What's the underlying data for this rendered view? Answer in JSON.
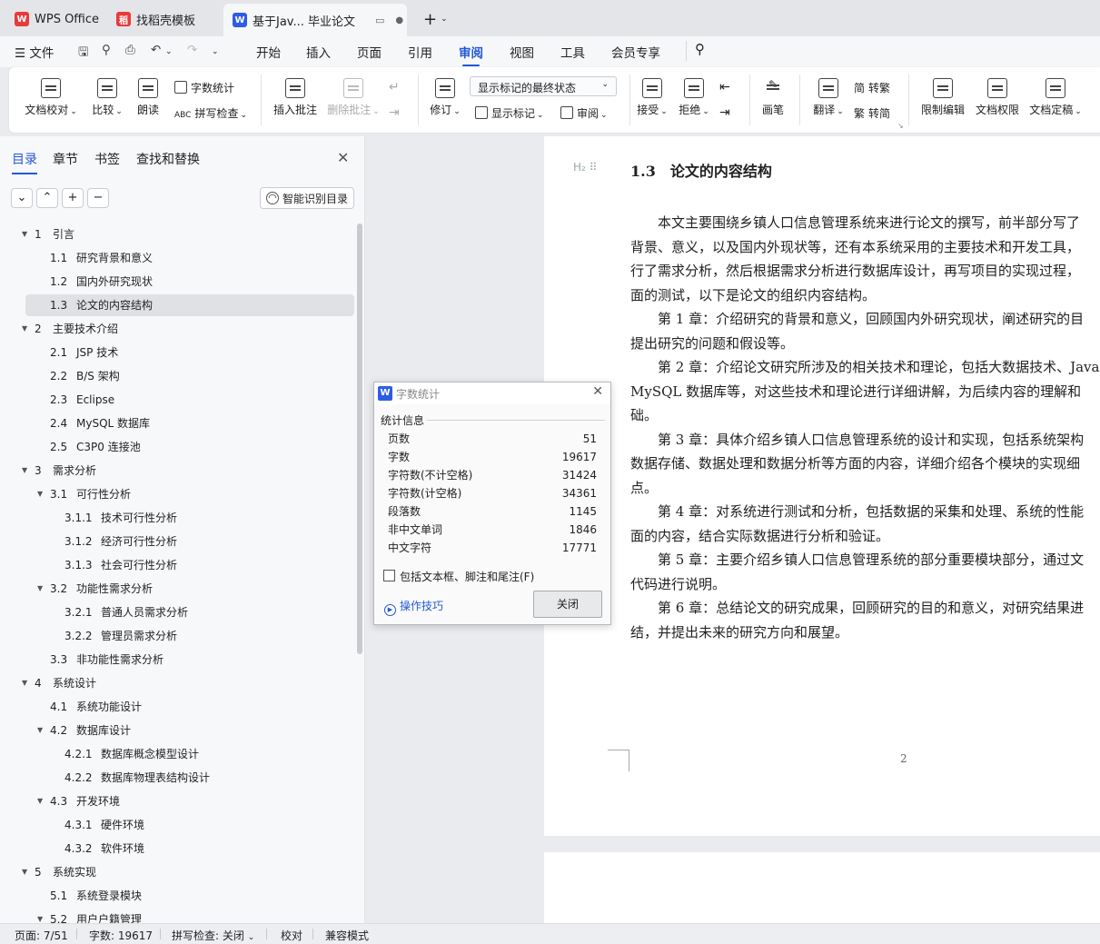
{
  "tabs": [
    {
      "label": "WPS Office",
      "icon": "wps-logo-icon"
    },
    {
      "label": "找稻壳模板",
      "icon": "docer-icon"
    },
    {
      "label": "基于Jav... 毕业论文",
      "icon": "writer-icon"
    }
  ],
  "menu": {
    "file": "文件",
    "items": [
      "开始",
      "插入",
      "页面",
      "引用",
      "审阅",
      "视图",
      "工具",
      "会员专享"
    ],
    "active": "审阅"
  },
  "ribbon": {
    "doc_check": "文档校对",
    "compare": "比较",
    "read_aloud": "朗读",
    "word_count": "字数统计",
    "spell_check": "拼写检查",
    "insert_comment": "插入批注",
    "delete_comment": "删除批注",
    "revise": "修订",
    "markup_state": "显示标记的最终状态",
    "show_markup": "显示标记",
    "review_pane": "审阅",
    "accept": "接受",
    "reject": "拒绝",
    "pen": "画笔",
    "translate": "翻译",
    "to_traditional": "转繁",
    "to_simplified": "转简",
    "restrict_edit": "限制编辑",
    "doc_permission": "文档权限",
    "doc_finalize": "文档定稿"
  },
  "sidebar": {
    "tabs": [
      "目录",
      "章节",
      "书签",
      "查找和替换"
    ],
    "smart_toc": "智能识别目录",
    "toc": [
      {
        "num": "1",
        "title": "引言",
        "level": 1,
        "expanded": true
      },
      {
        "num": "1.1",
        "title": "研究背景和意义",
        "level": 2
      },
      {
        "num": "1.2",
        "title": "国内外研究现状",
        "level": 2
      },
      {
        "num": "1.3",
        "title": "论文的内容结构",
        "level": 2,
        "selected": true
      },
      {
        "num": "2",
        "title": "主要技术介绍",
        "level": 1,
        "expanded": true
      },
      {
        "num": "2.1",
        "title": "JSP 技术",
        "level": 2
      },
      {
        "num": "2.2",
        "title": "B/S 架构",
        "level": 2
      },
      {
        "num": "2.3",
        "title": "Eclipse",
        "level": 2
      },
      {
        "num": "2.4",
        "title": "MySQL 数据库",
        "level": 2
      },
      {
        "num": "2.5",
        "title": "C3P0 连接池",
        "level": 2
      },
      {
        "num": "3",
        "title": "需求分析",
        "level": 1,
        "expanded": true
      },
      {
        "num": "3.1",
        "title": "可行性分析",
        "level": 2,
        "expanded": true
      },
      {
        "num": "3.1.1",
        "title": "技术可行性分析",
        "level": 3
      },
      {
        "num": "3.1.2",
        "title": "经济可行性分析",
        "level": 3
      },
      {
        "num": "3.1.3",
        "title": "社会可行性分析",
        "level": 3
      },
      {
        "num": "3.2",
        "title": "功能性需求分析",
        "level": 2,
        "expanded": true
      },
      {
        "num": "3.2.1",
        "title": "普通人员需求分析",
        "level": 3
      },
      {
        "num": "3.2.2",
        "title": "管理员需求分析",
        "level": 3
      },
      {
        "num": "3.3",
        "title": "非功能性需求分析",
        "level": 2
      },
      {
        "num": "4",
        "title": "系统设计",
        "level": 1,
        "expanded": true
      },
      {
        "num": "4.1",
        "title": "系统功能设计",
        "level": 2
      },
      {
        "num": "4.2",
        "title": "数据库设计",
        "level": 2,
        "expanded": true
      },
      {
        "num": "4.2.1",
        "title": "数据库概念模型设计",
        "level": 3
      },
      {
        "num": "4.2.2",
        "title": "数据库物理表结构设计",
        "level": 3
      },
      {
        "num": "4.3",
        "title": "开发环境",
        "level": 2,
        "expanded": true
      },
      {
        "num": "4.3.1",
        "title": "硬件环境",
        "level": 3
      },
      {
        "num": "4.3.2",
        "title": "软件环境",
        "level": 3
      },
      {
        "num": "5",
        "title": "系统实现",
        "level": 1,
        "expanded": true
      },
      {
        "num": "5.1",
        "title": "系统登录模块",
        "level": 2
      },
      {
        "num": "5.2",
        "title": "用户户籍管理",
        "level": 2,
        "expanded": true
      }
    ]
  },
  "document": {
    "heading_marker": "H₂",
    "heading": "1.3　论文的内容结构",
    "paragraphs": [
      "　　本文主要围绕乡镇人口信息管理系统来进行论文的撰写，前半部分写了",
      "背景、意义，以及国内外现状等，还有本系统采用的主要技术和开发工具，",
      "行了需求分析，然后根据需求分析进行数据库设计，再写项目的实现过程，",
      "面的测试，以下是论文的组织内容结构。",
      "　　第 1 章：介绍研究的背景和意义，回顾国内外研究现状，阐述研究的目",
      "提出研究的问题和假设等。",
      "　　第 2 章：介绍论文研究所涉及的相关技术和理论，包括大数据技术、Java",
      "MySQL 数据库等，对这些技术和理论进行详细讲解，为后续内容的理解和",
      "础。",
      "　　第 3 章：具体介绍乡镇人口信息管理系统的设计和实现，包括系统架构",
      "数据存储、数据处理和数据分析等方面的内容，详细介绍各个模块的实现细",
      "点。",
      "　　第 4 章：对系统进行测试和分析，包括数据的采集和处理、系统的性能",
      "面的内容，结合实际数据进行分析和验证。",
      "　　第 5 章：主要介绍乡镇人口信息管理系统的部分重要模块部分，通过文",
      "代码进行说明。",
      "　　第 6 章：总结论文的研究成果，回顾研究的目的和意义，对研究结果进",
      "结，并提出未来的研究方向和展望。"
    ],
    "page_number": "2"
  },
  "dialog": {
    "title": "字数统计",
    "section": "统计信息",
    "stats": [
      {
        "label": "页数",
        "value": "51"
      },
      {
        "label": "字数",
        "value": "19617"
      },
      {
        "label": "字符数(不计空格)",
        "value": "31424"
      },
      {
        "label": "字符数(计空格)",
        "value": "34361"
      },
      {
        "label": "段落数",
        "value": "1145"
      },
      {
        "label": "非中文单词",
        "value": "1846"
      },
      {
        "label": "中文字符",
        "value": "17771"
      }
    ],
    "checkbox_label": "包括文本框、脚注和尾注(F)",
    "tips": "操作技巧",
    "close": "关闭"
  },
  "statusbar": {
    "page": "页面: 7/51",
    "words": "字数: 19617",
    "spell": "拼写检查: 关闭",
    "proof": "校对",
    "compat": "兼容模式"
  },
  "colors": {
    "accent": "#2259d8",
    "wps_red": "#e8393b",
    "writer_blue": "#2e5ce6"
  }
}
